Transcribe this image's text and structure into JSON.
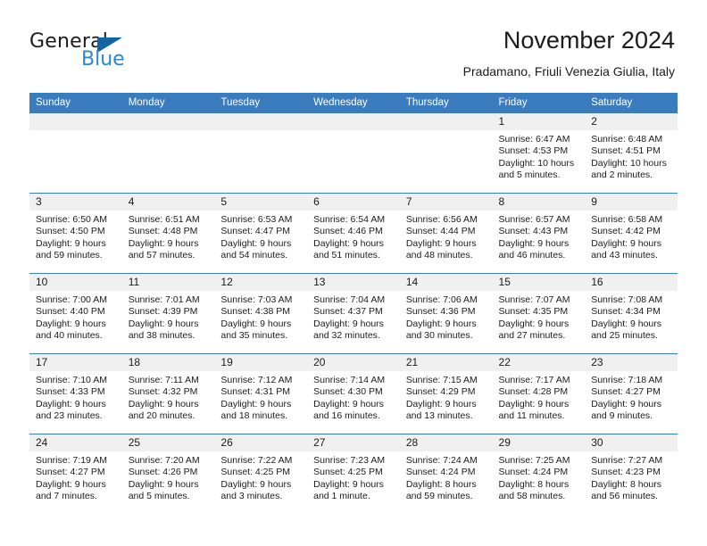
{
  "brand": {
    "name_dark": "General",
    "name_blue": "Blue",
    "triangle_icon": "blue-triangle-logo",
    "colors": {
      "dark": "#1b1b1b",
      "blue": "#2a87d0",
      "triangle": "#1464a5"
    }
  },
  "header": {
    "title": "November 2024",
    "subtitle": "Pradamano, Friuli Venezia Giulia, Italy"
  },
  "theme": {
    "header_bg": "#3a7cbe",
    "cell_head_bg": "#f0f0f0",
    "row_border": "#3a7cbe",
    "text": "#1b1b1b"
  },
  "weekdays": [
    "Sunday",
    "Monday",
    "Tuesday",
    "Wednesday",
    "Thursday",
    "Friday",
    "Saturday"
  ],
  "weeks": [
    [
      {
        "day": "",
        "empty": true
      },
      {
        "day": "",
        "empty": true
      },
      {
        "day": "",
        "empty": true
      },
      {
        "day": "",
        "empty": true
      },
      {
        "day": "",
        "empty": true
      },
      {
        "day": "1",
        "sunrise": "Sunrise: 6:47 AM",
        "sunset": "Sunset: 4:53 PM",
        "daylight1": "Daylight: 10 hours",
        "daylight2": "and 5 minutes."
      },
      {
        "day": "2",
        "sunrise": "Sunrise: 6:48 AM",
        "sunset": "Sunset: 4:51 PM",
        "daylight1": "Daylight: 10 hours",
        "daylight2": "and 2 minutes."
      }
    ],
    [
      {
        "day": "3",
        "sunrise": "Sunrise: 6:50 AM",
        "sunset": "Sunset: 4:50 PM",
        "daylight1": "Daylight: 9 hours",
        "daylight2": "and 59 minutes."
      },
      {
        "day": "4",
        "sunrise": "Sunrise: 6:51 AM",
        "sunset": "Sunset: 4:48 PM",
        "daylight1": "Daylight: 9 hours",
        "daylight2": "and 57 minutes."
      },
      {
        "day": "5",
        "sunrise": "Sunrise: 6:53 AM",
        "sunset": "Sunset: 4:47 PM",
        "daylight1": "Daylight: 9 hours",
        "daylight2": "and 54 minutes."
      },
      {
        "day": "6",
        "sunrise": "Sunrise: 6:54 AM",
        "sunset": "Sunset: 4:46 PM",
        "daylight1": "Daylight: 9 hours",
        "daylight2": "and 51 minutes."
      },
      {
        "day": "7",
        "sunrise": "Sunrise: 6:56 AM",
        "sunset": "Sunset: 4:44 PM",
        "daylight1": "Daylight: 9 hours",
        "daylight2": "and 48 minutes."
      },
      {
        "day": "8",
        "sunrise": "Sunrise: 6:57 AM",
        "sunset": "Sunset: 4:43 PM",
        "daylight1": "Daylight: 9 hours",
        "daylight2": "and 46 minutes."
      },
      {
        "day": "9",
        "sunrise": "Sunrise: 6:58 AM",
        "sunset": "Sunset: 4:42 PM",
        "daylight1": "Daylight: 9 hours",
        "daylight2": "and 43 minutes."
      }
    ],
    [
      {
        "day": "10",
        "sunrise": "Sunrise: 7:00 AM",
        "sunset": "Sunset: 4:40 PM",
        "daylight1": "Daylight: 9 hours",
        "daylight2": "and 40 minutes."
      },
      {
        "day": "11",
        "sunrise": "Sunrise: 7:01 AM",
        "sunset": "Sunset: 4:39 PM",
        "daylight1": "Daylight: 9 hours",
        "daylight2": "and 38 minutes."
      },
      {
        "day": "12",
        "sunrise": "Sunrise: 7:03 AM",
        "sunset": "Sunset: 4:38 PM",
        "daylight1": "Daylight: 9 hours",
        "daylight2": "and 35 minutes."
      },
      {
        "day": "13",
        "sunrise": "Sunrise: 7:04 AM",
        "sunset": "Sunset: 4:37 PM",
        "daylight1": "Daylight: 9 hours",
        "daylight2": "and 32 minutes."
      },
      {
        "day": "14",
        "sunrise": "Sunrise: 7:06 AM",
        "sunset": "Sunset: 4:36 PM",
        "daylight1": "Daylight: 9 hours",
        "daylight2": "and 30 minutes."
      },
      {
        "day": "15",
        "sunrise": "Sunrise: 7:07 AM",
        "sunset": "Sunset: 4:35 PM",
        "daylight1": "Daylight: 9 hours",
        "daylight2": "and 27 minutes."
      },
      {
        "day": "16",
        "sunrise": "Sunrise: 7:08 AM",
        "sunset": "Sunset: 4:34 PM",
        "daylight1": "Daylight: 9 hours",
        "daylight2": "and 25 minutes."
      }
    ],
    [
      {
        "day": "17",
        "sunrise": "Sunrise: 7:10 AM",
        "sunset": "Sunset: 4:33 PM",
        "daylight1": "Daylight: 9 hours",
        "daylight2": "and 23 minutes."
      },
      {
        "day": "18",
        "sunrise": "Sunrise: 7:11 AM",
        "sunset": "Sunset: 4:32 PM",
        "daylight1": "Daylight: 9 hours",
        "daylight2": "and 20 minutes."
      },
      {
        "day": "19",
        "sunrise": "Sunrise: 7:12 AM",
        "sunset": "Sunset: 4:31 PM",
        "daylight1": "Daylight: 9 hours",
        "daylight2": "and 18 minutes."
      },
      {
        "day": "20",
        "sunrise": "Sunrise: 7:14 AM",
        "sunset": "Sunset: 4:30 PM",
        "daylight1": "Daylight: 9 hours",
        "daylight2": "and 16 minutes."
      },
      {
        "day": "21",
        "sunrise": "Sunrise: 7:15 AM",
        "sunset": "Sunset: 4:29 PM",
        "daylight1": "Daylight: 9 hours",
        "daylight2": "and 13 minutes."
      },
      {
        "day": "22",
        "sunrise": "Sunrise: 7:17 AM",
        "sunset": "Sunset: 4:28 PM",
        "daylight1": "Daylight: 9 hours",
        "daylight2": "and 11 minutes."
      },
      {
        "day": "23",
        "sunrise": "Sunrise: 7:18 AM",
        "sunset": "Sunset: 4:27 PM",
        "daylight1": "Daylight: 9 hours",
        "daylight2": "and 9 minutes."
      }
    ],
    [
      {
        "day": "24",
        "sunrise": "Sunrise: 7:19 AM",
        "sunset": "Sunset: 4:27 PM",
        "daylight1": "Daylight: 9 hours",
        "daylight2": "and 7 minutes."
      },
      {
        "day": "25",
        "sunrise": "Sunrise: 7:20 AM",
        "sunset": "Sunset: 4:26 PM",
        "daylight1": "Daylight: 9 hours",
        "daylight2": "and 5 minutes."
      },
      {
        "day": "26",
        "sunrise": "Sunrise: 7:22 AM",
        "sunset": "Sunset: 4:25 PM",
        "daylight1": "Daylight: 9 hours",
        "daylight2": "and 3 minutes."
      },
      {
        "day": "27",
        "sunrise": "Sunrise: 7:23 AM",
        "sunset": "Sunset: 4:25 PM",
        "daylight1": "Daylight: 9 hours",
        "daylight2": "and 1 minute."
      },
      {
        "day": "28",
        "sunrise": "Sunrise: 7:24 AM",
        "sunset": "Sunset: 4:24 PM",
        "daylight1": "Daylight: 8 hours",
        "daylight2": "and 59 minutes."
      },
      {
        "day": "29",
        "sunrise": "Sunrise: 7:25 AM",
        "sunset": "Sunset: 4:24 PM",
        "daylight1": "Daylight: 8 hours",
        "daylight2": "and 58 minutes."
      },
      {
        "day": "30",
        "sunrise": "Sunrise: 7:27 AM",
        "sunset": "Sunset: 4:23 PM",
        "daylight1": "Daylight: 8 hours",
        "daylight2": "and 56 minutes."
      }
    ]
  ]
}
